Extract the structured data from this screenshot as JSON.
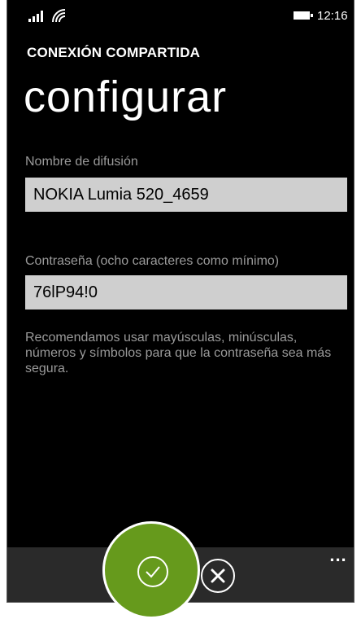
{
  "status_bar": {
    "time": "12:16",
    "icons": [
      "signal-icon",
      "wifi-icon",
      "battery-icon"
    ]
  },
  "header": {
    "app_title": "CONEXIÓN COMPARTIDA",
    "page_title": "configurar"
  },
  "form": {
    "broadcast_name": {
      "label": "Nombre de difusión",
      "value": "NOKIA Lumia 520_4659"
    },
    "password": {
      "label": "Contraseña (ocho caracteres como mínimo)",
      "value": "76lP94!0"
    },
    "hint": "Recomendamos usar mayúsculas, minúsculas, números y símbolos para que la contraseña sea más segura."
  },
  "app_bar": {
    "buttons": [
      "checkmark-icon",
      "close-icon"
    ],
    "more": "..."
  },
  "colors": {
    "background": "#000000",
    "input_background": "#cfcfcf",
    "label_text": "#9a9a9a",
    "app_bar": "#2a2a2a",
    "touch_highlight": "#669a1c"
  }
}
